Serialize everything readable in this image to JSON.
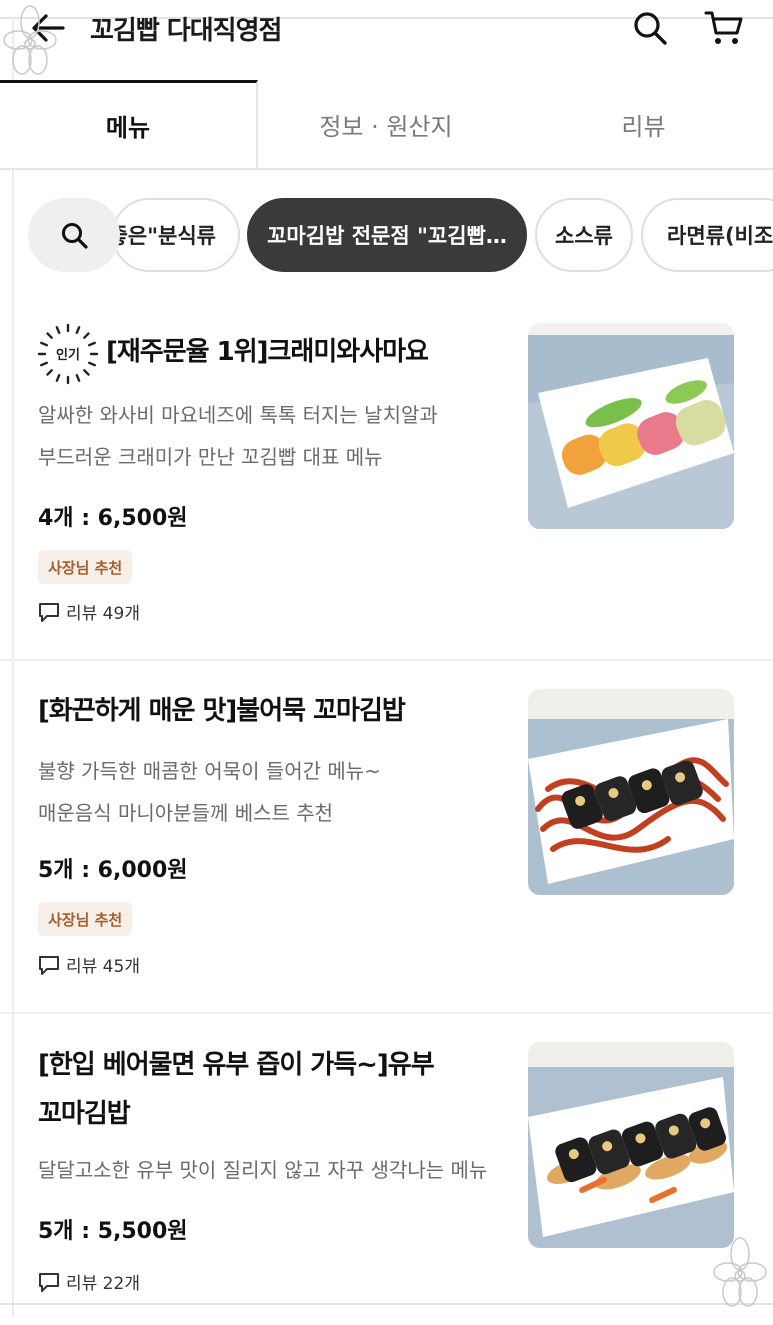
{
  "header": {
    "title": "꼬김빱 다대직영점"
  },
  "tabs": [
    {
      "label": "메뉴"
    },
    {
      "label": "정보 · 원산지"
    },
    {
      "label": "리뷰"
    }
  ],
  "chips": [
    {
      "label": "좋은\"분식류"
    },
    {
      "label": "꼬마김밥 전문점 \"꼬김빱…"
    },
    {
      "label": "소스류"
    },
    {
      "label": "라면류(비조리"
    }
  ],
  "items": [
    {
      "popular_label": "인기",
      "name": "[재주문율 1위]크래미와사마요",
      "desc": "알싸한 와사비 마요네즈에 톡톡 터지는 날치알과\n부드러운 크래미가 만난 꼬김빱 대표 메뉴",
      "price": "4개 : 6,500원",
      "badge": "사장님 추천",
      "review": "리뷰 49개"
    },
    {
      "name": "[화끈하게 매운 맛]불어묵 꼬마김밥",
      "desc": "불향 가득한 매콤한 어묵이 들어간 메뉴~\n 매운음식 마니아분들께 베스트 추천",
      "price": "5개 : 6,000원",
      "badge": "사장님 추천",
      "review": "리뷰 45개"
    },
    {
      "name_line1": "[한입 베어물면 유부 즙이 가득~]유부",
      "name_line2": "꼬마김밥",
      "desc": "달달고소한 유부 맛이 질리지 않고 자꾸 생각나는 메뉴",
      "price": "5개 : 5,500원",
      "review": "리뷰 22개"
    }
  ]
}
